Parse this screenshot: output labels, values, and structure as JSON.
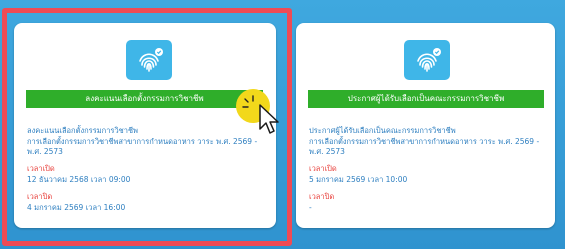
{
  "cards": [
    {
      "button": "ลงคะแนนเลือกตั้งกรรมการวิชาชีพ",
      "title": "ลงคะแนนเลือกตั้งกรรมการวิชาชีพ",
      "subtitle": "การเลือกตั้งกรรมการวิชาชีพสาขาการกำหนดอาหาร วาระ พ.ศ. 2569 - พ.ศ. 2573",
      "open_label": "เวลาเปิด",
      "open_value": "12 ธันวาคม 2568 เวลา 09:00",
      "close_label": "เวลาปิด",
      "close_value": "4 มกราคม 2569 เวลา 16:00"
    },
    {
      "button": "ประกาศผู้ได้รับเลือกเป็นคณะกรรมการวิชาชีพ",
      "title": "ประกาศผู้ได้รับเลือกเป็นคณะกรรมการวิชาชีพ",
      "subtitle": "การเลือกตั้งกรรมการวิชาชีพสาขาการกำหนดอาหาร วาระ พ.ศ. 2569 - พ.ศ. 2573",
      "open_label": "เวลาเปิด",
      "open_value": "5 มกราคม 2569 เวลา 10:00",
      "close_label": "เวลาปิด",
      "close_value": "-"
    }
  ],
  "icon": "fingerprint-icon",
  "colors": {
    "background": "#3aa0d6",
    "button_green": "#2fae2a",
    "text_blue": "#2e7fc0",
    "text_red": "#e8413c",
    "highlight_red": "#ee4b55",
    "icon_blue": "#3fb6e8",
    "cursor_yellow": "#f2d81b"
  }
}
